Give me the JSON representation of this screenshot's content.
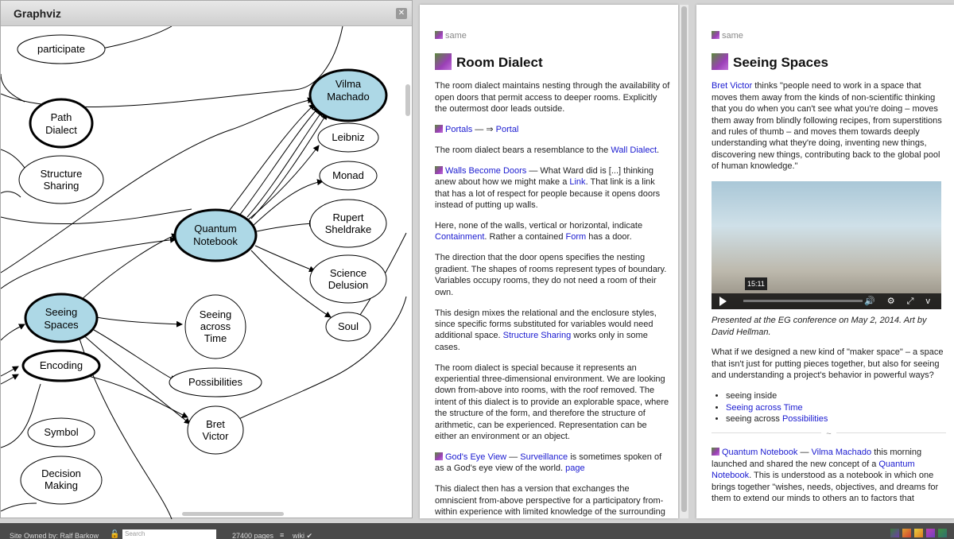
{
  "graphviz": {
    "title": "Graphviz",
    "close": "✕",
    "nodes": {
      "participate": "participate",
      "path": [
        "Path",
        "Dialect"
      ],
      "structure": [
        "Structure",
        "Sharing"
      ],
      "vilma": [
        "Vilma",
        "Machado"
      ],
      "leibniz": "Leibniz",
      "monad": "Monad",
      "rupert": [
        "Rupert",
        "Sheldrake"
      ],
      "quantum": [
        "Quantum",
        "Notebook"
      ],
      "science": [
        "Science",
        "Delusion"
      ],
      "seeing": [
        "Seeing",
        "Spaces"
      ],
      "across": [
        "Seeing",
        "across",
        "Time"
      ],
      "soul": "Soul",
      "encoding": "Encoding",
      "possibilities": "Possibilities",
      "bret": [
        "Bret",
        "Victor"
      ],
      "symbol": "Symbol",
      "decision": [
        "Decision",
        "Making"
      ]
    }
  },
  "page1": {
    "same": "same",
    "title": "Room Dialect",
    "p1": "The room dialect maintains nesting through the availability of open doors that permit access to deeper rooms. Explicitly the outermost door leads outside.",
    "portals": {
      "link": "Portals",
      "sep": " — ⇒ ",
      "target": "Portal"
    },
    "p3_pre": "The room dialect bears a resemblance to the ",
    "p3_link": "Wall Dialect",
    "p3_post": ".",
    "walls_link": "Walls Become Doors",
    "walls_pre": " — What Ward did is [...] thinking anew about how we might make a ",
    "walls_link2": "Link",
    "walls_post": ". That link is a link that has a lot of respect for people because it opens doors instead of putting up walls.",
    "p5_pre": "Here, none of the walls, vertical or horizontal, indicate ",
    "p5_link1": "Containment",
    "p5_mid": ". Rather a contained ",
    "p5_link2": "Form",
    "p5_post": " has a door.",
    "p6": "The direction that the door opens specifies the nesting gradient. The shapes of rooms represent types of boundary. Variables occupy rooms, they do not need a room of their own.",
    "p7_pre": "This design mixes the relational and the enclosure styles, since specific forms substituted for variables would need additional space. ",
    "p7_link": "Structure Sharing",
    "p7_post": " works only in some cases.",
    "p8": "The room dialect is special because it represents an experiential three-dimensional environment. We are looking down from-above into rooms, with the roof removed. The intent of this dialect is to provide an explorable space, where the structure of the form, and therefore the structure of arithmetic, can be experienced. Representation can be either an environment or an object.",
    "gods_link": "God's Eye View",
    "gods_sep": " — ",
    "gods_link2": "Surveillance",
    "gods_post": " is sometimes spoken of as a God's eye view of the world. ",
    "gods_page": "page",
    "p10": "This dialect then has a version that exchanges the omniscient from-above perspective for a participatory from-within experience with limited knowledge of the surrounding structure or rooms."
  },
  "page2": {
    "same": "same",
    "title": "Seeing Spaces",
    "q_link": "Bret Victor",
    "q_text": " thinks \"people need to work in a space that moves them away from the kinds of non-scientific thinking that you do when you can't see what you're doing – moves them away from blindly following recipes, from superstitions and rules of thumb – and moves them towards deeply understanding what they're doing, inventing new things, discovering new things, contributing back to the global pool of human knowledge.\"",
    "video_time": "15:11",
    "video_controls": "🔊 ⚙ ⤢ v",
    "caption": "Presented at the EG conference on May 2, 2014. Art by David Hellman.",
    "p2": "What if we designed a new kind of \"maker space\" – a space that isn't just for putting pieces together, but also for seeing and understanding a project's behavior in powerful ways?",
    "li1": "seeing inside",
    "li2": "Seeing across Time",
    "li3_pre": "seeing across ",
    "li3_link": "Possibilities",
    "sep": "~",
    "qn_link": "Quantum Notebook",
    "qn_sep": " — ",
    "qn_link2": "Vilma Machado",
    "qn_mid": " this morning launched and shared the new concept of a ",
    "qn_link3": "Quantum Notebook",
    "qn_post": ". This is understood as a notebook in which one brings together \"wishes, needs, objectives, and dreams for them to extend our minds to others an to factors that"
  },
  "footer": {
    "owner": "Site Owned by: Ralf Barkow",
    "search_placeholder": "Search",
    "pages": "27400 pages",
    "list_icon": "≡",
    "wiki": "wiki ✔"
  }
}
